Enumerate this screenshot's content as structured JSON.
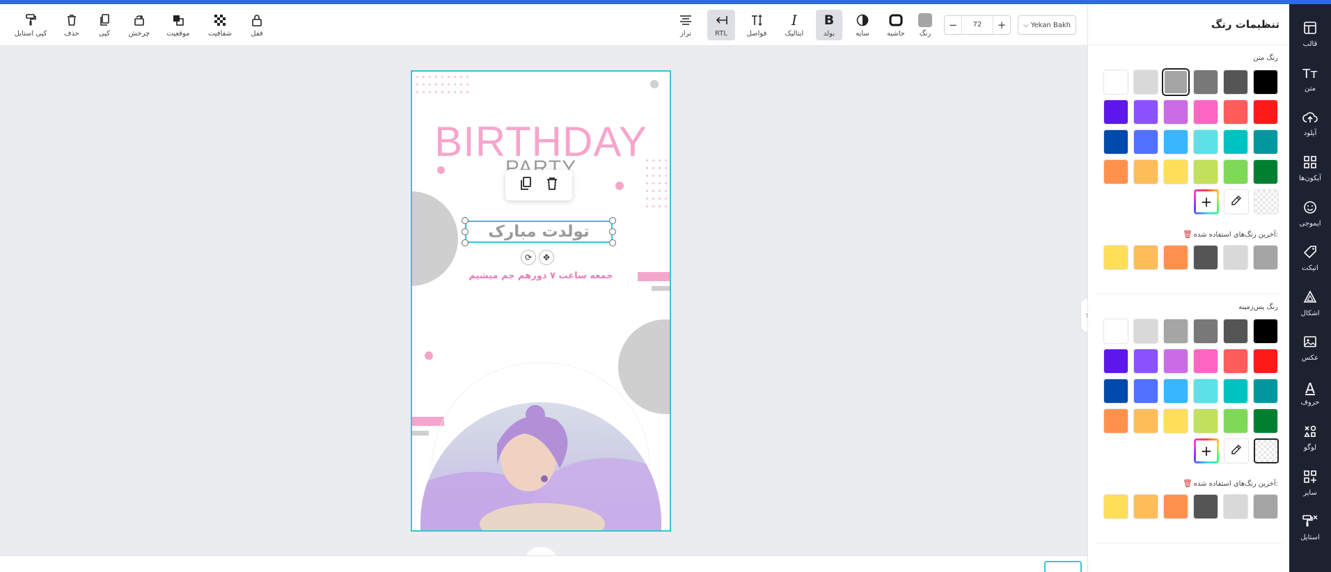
{
  "toolbar": {
    "left_actions": [
      {
        "key": "copy_style",
        "label": "کپی استایل",
        "icon": "paint-roller-icon"
      },
      {
        "key": "delete",
        "label": "حذف",
        "icon": "trash-icon"
      },
      {
        "key": "copy",
        "label": "کپی",
        "icon": "copy-icon"
      },
      {
        "key": "rotate",
        "label": "چرخش",
        "icon": "rotate-icon"
      },
      {
        "key": "position",
        "label": "موقعیت",
        "icon": "layers-icon"
      },
      {
        "key": "opacity",
        "label": "شفافیت",
        "icon": "checker-icon"
      },
      {
        "key": "lock",
        "label": "قفل",
        "icon": "lock-icon"
      }
    ],
    "format_actions": [
      {
        "key": "align",
        "label": "تراز",
        "icon": "align-center-icon"
      },
      {
        "key": "rtl",
        "label": "RTL",
        "icon": "rtl-arrow-icon",
        "active": true
      },
      {
        "key": "spacing",
        "label": "فواصل",
        "icon": "text-spacing-icon"
      },
      {
        "key": "italic",
        "label": "ایتالیک",
        "icon": "italic-icon"
      },
      {
        "key": "bold",
        "label": "بولد",
        "icon": "bold-icon",
        "active": true
      },
      {
        "key": "shadow",
        "label": "سایه",
        "icon": "shadow-icon"
      },
      {
        "key": "border",
        "label": "حاشیه",
        "icon": "border-icon"
      },
      {
        "key": "color",
        "label": "رنگ",
        "icon": "color-icon"
      }
    ],
    "font_size": "72",
    "font_name": "Yekan Bakh"
  },
  "design": {
    "title": "BIRTHDAY",
    "subtitle": "PARTY",
    "selected_text": "تولدت مبارک",
    "sub_text": "جمعه ساعت ۷ دورهم جم میشیم"
  },
  "panel": {
    "title": "تنظیمات رنگ",
    "text_color_label": "رنگ متن",
    "recent_label": "آخرین رنگ‌های استفاده شده:",
    "bg_color_label": "رنگ پس‌زمینه",
    "palette": [
      [
        "#000000",
        "#555555",
        "#787878",
        "#a5a5a5",
        "#d9d9d9",
        "#ffffff"
      ],
      [
        "#ff1a1a",
        "#ff5c5c",
        "#ff66c4",
        "#cb6ce6",
        "#8c52ff",
        "#5e17eb"
      ],
      [
        "#03989e",
        "#00c2c0",
        "#5ce1e6",
        "#38b6ff",
        "#5271ff",
        "#004aad"
      ],
      [
        "#00802f",
        "#7ed957",
        "#c1e15a",
        "#ffde59",
        "#ffbd59",
        "#ff914d"
      ]
    ],
    "recent": [
      "#a5a5a5",
      "#d9d9d9",
      "#555555",
      "#ff914d",
      "#ffbd59",
      "#ffde59"
    ]
  },
  "sidebar": [
    {
      "label": "قالب",
      "icon": "template-icon"
    },
    {
      "label": "متن",
      "icon": "text-icon"
    },
    {
      "label": "آپلود",
      "icon": "upload-icon"
    },
    {
      "label": "آیکون‌ها",
      "icon": "grid-icon"
    },
    {
      "label": "ایموجی",
      "icon": "emoji-icon"
    },
    {
      "label": "اتیکت",
      "icon": "tag-icon"
    },
    {
      "label": "اشکال",
      "icon": "shapes-icon"
    },
    {
      "label": "عکس",
      "icon": "image-icon"
    },
    {
      "label": "حروف",
      "icon": "letter-icon"
    },
    {
      "label": "لوگو",
      "icon": "logo-icon"
    },
    {
      "label": "سایر",
      "icon": "more-icon"
    },
    {
      "label": "استایل",
      "icon": "style-icon"
    }
  ]
}
